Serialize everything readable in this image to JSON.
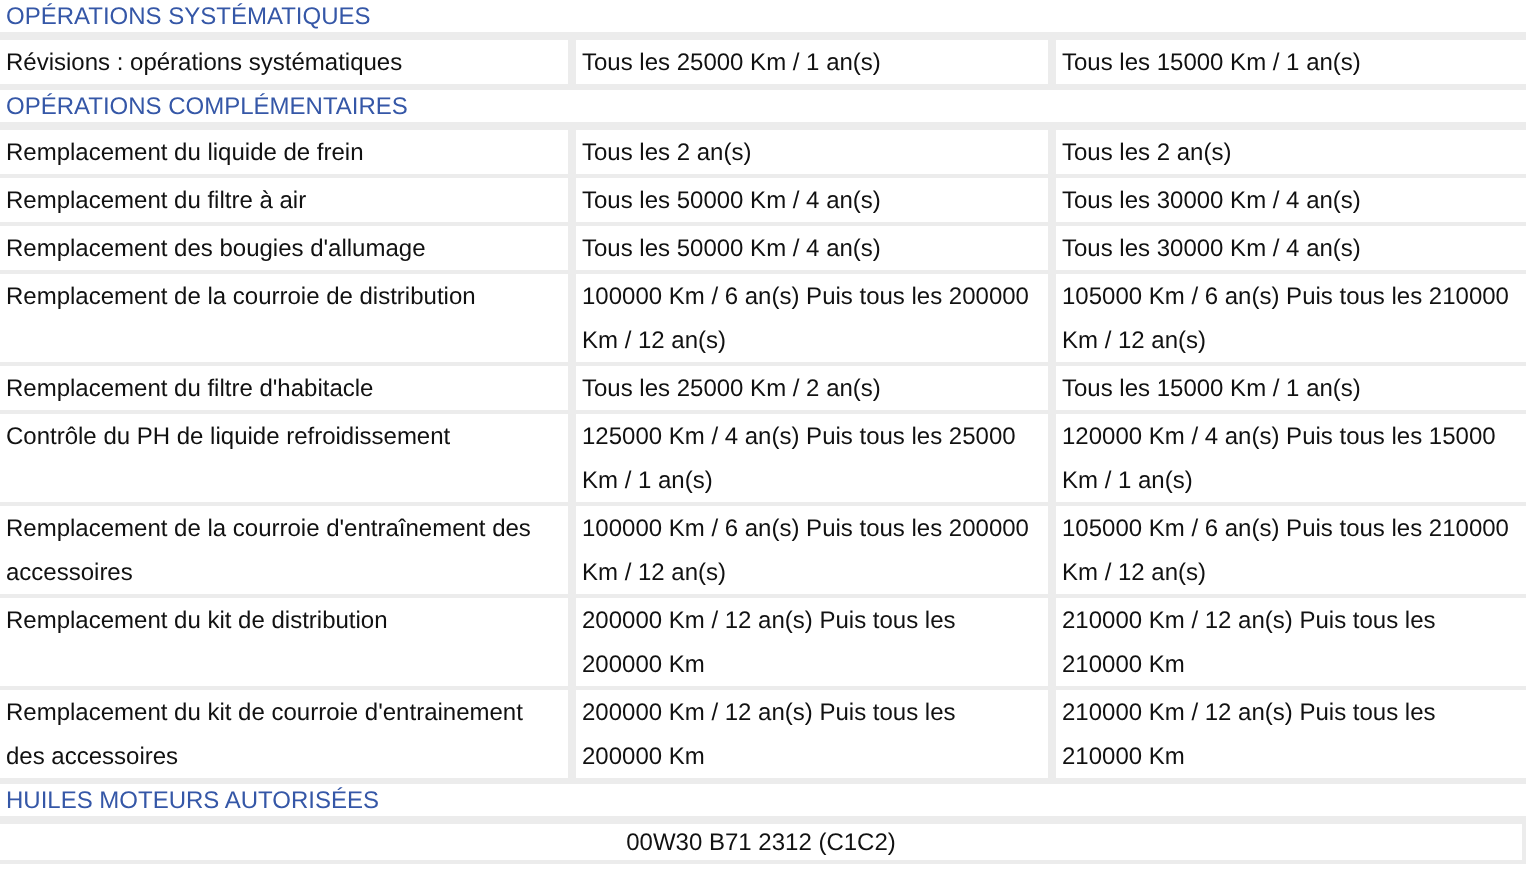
{
  "sections": [
    {
      "title": "OPÉRATIONS SYSTÉMATIQUES",
      "kind": "table",
      "rows": [
        {
          "operation": "Révisions : opérations systématiques",
          "intervals": [
            "Tous les 25000 Km / 1 an(s)",
            "Tous les 15000 Km / 1 an(s)"
          ]
        }
      ]
    },
    {
      "title": "OPÉRATIONS COMPLÉMENTAIRES",
      "kind": "table",
      "rows": [
        {
          "operation": "Remplacement du liquide de frein",
          "intervals": [
            "Tous les 2 an(s)",
            "Tous les 2 an(s)"
          ]
        },
        {
          "operation": "Remplacement du filtre à air",
          "intervals": [
            "Tous les 50000 Km / 4 an(s)",
            "Tous les 30000 Km / 4 an(s)"
          ]
        },
        {
          "operation": "Remplacement des bougies d'allumage",
          "intervals": [
            "Tous les 50000 Km / 4 an(s)",
            "Tous les 30000 Km / 4 an(s)"
          ]
        },
        {
          "operation": "Remplacement de la courroie de distribution",
          "intervals": [
            "100000 Km / 6 an(s) Puis tous les 200000 Km / 12 an(s)",
            "105000 Km / 6 an(s) Puis tous les 210000 Km / 12 an(s)"
          ]
        },
        {
          "operation": "Remplacement du filtre d'habitacle",
          "intervals": [
            "Tous les 25000 Km / 2 an(s)",
            "Tous les 15000 Km / 1 an(s)"
          ]
        },
        {
          "operation": "Contrôle du PH de liquide refroidissement",
          "intervals": [
            "125000 Km / 4 an(s) Puis tous les 25000 Km / 1 an(s)",
            "120000 Km / 4 an(s) Puis tous les 15000 Km / 1 an(s)"
          ]
        },
        {
          "operation": "Remplacement de la courroie d'entraînement des accessoires",
          "intervals": [
            "100000 Km / 6 an(s) Puis tous les 200000 Km / 12 an(s)",
            "105000 Km / 6 an(s) Puis tous les 210000 Km / 12 an(s)"
          ]
        },
        {
          "operation": "Remplacement du kit de distribution",
          "intervals": [
            "200000 Km / 12 an(s) Puis tous les 200000 Km",
            "210000 Km / 12 an(s) Puis tous les 210000 Km"
          ]
        },
        {
          "operation": "Remplacement du kit de courroie d'entrainement des accessoires",
          "intervals": [
            "200000 Km / 12 an(s) Puis tous les 200000 Km",
            "210000 Km / 12 an(s) Puis tous les 210000 Km"
          ]
        }
      ]
    },
    {
      "title": "HUILES MOTEURS AUTORISÉES",
      "kind": "list",
      "items": [
        "00W30 B71 2312 (C1C2)"
      ]
    }
  ]
}
